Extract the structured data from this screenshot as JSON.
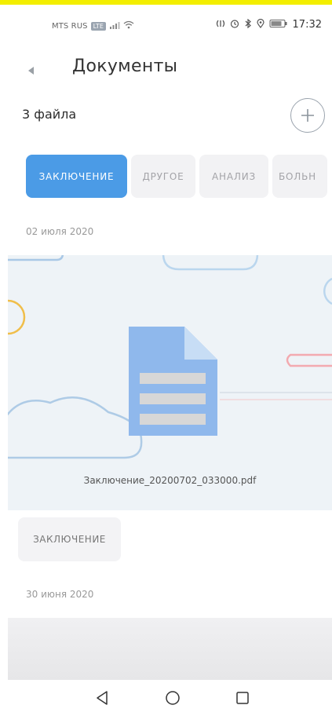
{
  "status_bar": {
    "carrier": "MTS RUS",
    "network_badge": "LTE",
    "time": "17:32",
    "icons": [
      "signal-icon",
      "wifi-icon",
      "nfc-icon",
      "alarm-icon",
      "bluetooth-icon",
      "location-icon",
      "battery-icon"
    ]
  },
  "header": {
    "title": "Документы",
    "back_icon": "back-arrow-icon"
  },
  "summary": {
    "file_count": "3 файла",
    "add_icon": "plus-icon"
  },
  "filters": [
    {
      "label": "ЗАКЛЮЧЕНИЕ",
      "active": true
    },
    {
      "label": "ДРУГОЕ",
      "active": false
    },
    {
      "label": "АНАЛИЗ",
      "active": false
    },
    {
      "label": "БОЛЬН",
      "active": false
    }
  ],
  "documents": [
    {
      "date": "02 июля 2020",
      "file_name": "Заключение_20200702_033000.pdf",
      "tag": "ЗАКЛЮЧЕНИЕ"
    },
    {
      "date": "30 июня 2020"
    }
  ],
  "nav_bar": {
    "icons": [
      "nav-back-icon",
      "nav-home-icon",
      "nav-recents-icon"
    ]
  },
  "colors": {
    "accent": "#4b9be6",
    "chip_bg": "#f2f2f4",
    "card_bg": "#eef3f7",
    "top_strip": "#f3ee00"
  }
}
